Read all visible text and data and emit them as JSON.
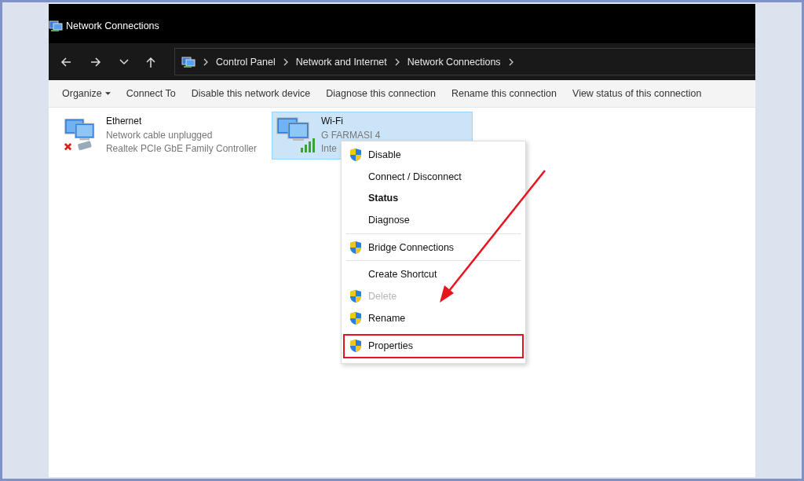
{
  "window": {
    "title": "Network Connections"
  },
  "address_bar": {
    "path": [
      "Control Panel",
      "Network and Internet",
      "Network Connections"
    ]
  },
  "toolbar": [
    {
      "label": "Organize",
      "dropdown": true
    },
    {
      "label": "Connect To",
      "dropdown": false
    },
    {
      "label": "Disable this network device",
      "dropdown": false
    },
    {
      "label": "Diagnose this connection",
      "dropdown": false
    },
    {
      "label": "Rename this connection",
      "dropdown": false
    },
    {
      "label": "View status of this connection",
      "dropdown": false
    }
  ],
  "connections": [
    {
      "name": "Ethernet",
      "lines": [
        "Network cable unplugged",
        "Realtek PCIe GbE Family Controller"
      ],
      "kind": "ethernet",
      "selected": false
    },
    {
      "name": "Wi-Fi",
      "lines": [
        "G FARMASI 4",
        "Inte"
      ],
      "kind": "wifi",
      "selected": true
    }
  ],
  "context_menu": [
    {
      "kind": "item",
      "label": "Disable",
      "shield": true,
      "bold": false,
      "disabled": false,
      "highlighted": false
    },
    {
      "kind": "item",
      "label": "Connect / Disconnect",
      "shield": false,
      "bold": false,
      "disabled": false,
      "highlighted": false
    },
    {
      "kind": "item",
      "label": "Status",
      "shield": false,
      "bold": true,
      "disabled": false,
      "highlighted": false
    },
    {
      "kind": "item",
      "label": "Diagnose",
      "shield": false,
      "bold": false,
      "disabled": false,
      "highlighted": false
    },
    {
      "kind": "separator"
    },
    {
      "kind": "item",
      "label": "Bridge Connections",
      "shield": true,
      "bold": false,
      "disabled": false,
      "highlighted": false
    },
    {
      "kind": "separator"
    },
    {
      "kind": "item",
      "label": "Create Shortcut",
      "shield": false,
      "bold": false,
      "disabled": false,
      "highlighted": false
    },
    {
      "kind": "item",
      "label": "Delete",
      "shield": true,
      "bold": false,
      "disabled": true,
      "highlighted": false
    },
    {
      "kind": "item",
      "label": "Rename",
      "shield": true,
      "bold": false,
      "disabled": false,
      "highlighted": false
    },
    {
      "kind": "item",
      "label": "Properties",
      "shield": true,
      "bold": false,
      "disabled": false,
      "highlighted": true
    }
  ]
}
